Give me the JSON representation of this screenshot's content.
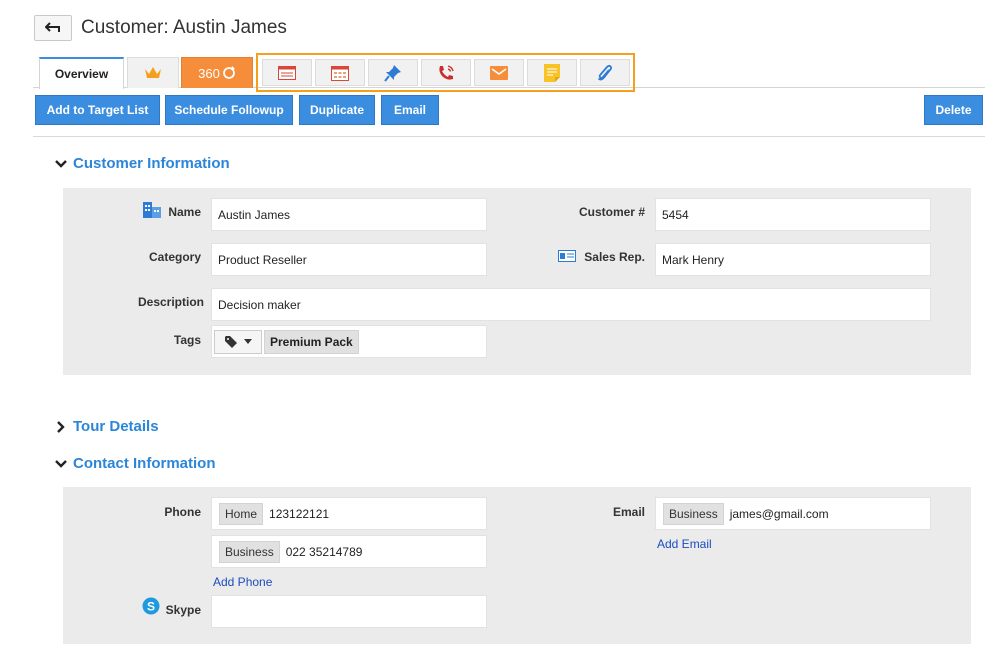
{
  "header": {
    "title": "Customer: Austin James"
  },
  "tabs": {
    "overview": "Overview",
    "tab_360_label": "360"
  },
  "tool_icons": [
    "list-icon",
    "calendar-icon",
    "pin-icon",
    "phone-icon",
    "mail-icon",
    "note-icon",
    "attachment-icon"
  ],
  "actions": {
    "add_to_target_list": "Add to Target List",
    "schedule_followup": "Schedule Followup",
    "duplicate": "Duplicate",
    "email": "Email",
    "delete": "Delete"
  },
  "customer_info": {
    "heading": "Customer Information",
    "name_label": "Name",
    "name_value": "Austin James",
    "customer_no_label": "Customer #",
    "customer_no_value": "5454",
    "category_label": "Category",
    "category_value": "Product Reseller",
    "sales_rep_label": "Sales Rep.",
    "sales_rep_value": "Mark Henry",
    "description_label": "Description",
    "description_value": "Decision maker",
    "tags_label": "Tags",
    "tag_value": "Premium Pack"
  },
  "tour_details": {
    "heading": "Tour Details"
  },
  "contact_info": {
    "heading": "Contact Information",
    "phone_label": "Phone",
    "phones": [
      {
        "type": "Home",
        "number": "123122121"
      },
      {
        "type": "Business",
        "number": "022 35214789"
      }
    ],
    "add_phone": "Add Phone",
    "email_label": "Email",
    "email_type": "Business",
    "email_value": "james@gmail.com",
    "add_email": "Add Email",
    "skype_label": "Skype",
    "skype_value": ""
  },
  "colors": {
    "accent": "#3b8de0",
    "orange": "#f58d3a",
    "highlight_border": "#f5a01d",
    "link": "#2b86d9"
  }
}
